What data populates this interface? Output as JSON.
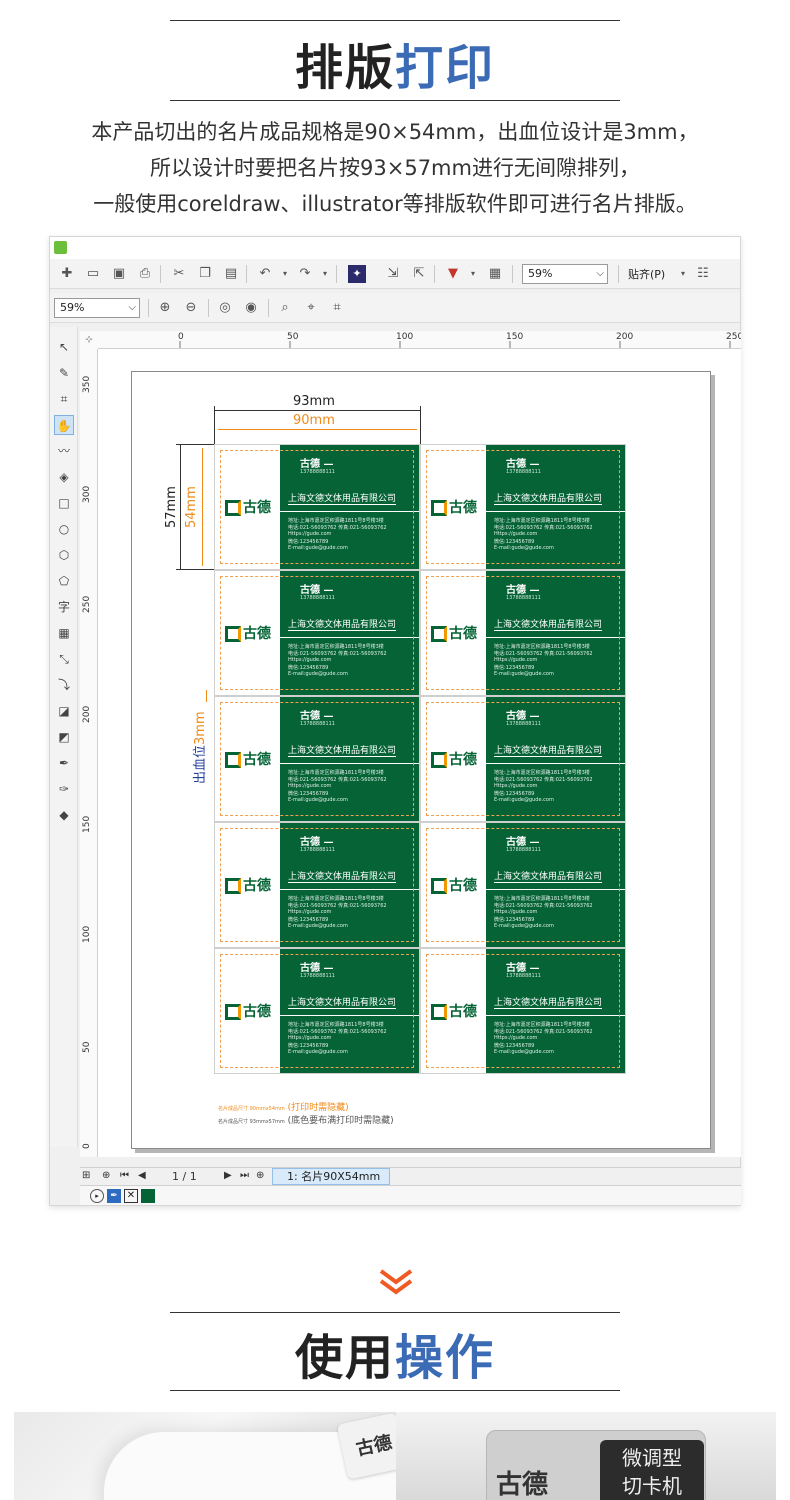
{
  "section1": {
    "title_black": "排版",
    "title_blue": "打印"
  },
  "intro": [
    "本产品切出的名片成品规格是90×54mm，出血位设计是3mm，",
    "所以设计时要把名片按93×57mm进行无间隙排列，",
    "一般使用coreldraw、illustrator等排版软件即可进行名片排版。"
  ],
  "app": {
    "zoom": "59%",
    "zoom_secondary": "59%",
    "snap_label": "贴齐(P)",
    "ruler_h": [
      "0",
      "50",
      "100",
      "150",
      "200",
      "250"
    ],
    "ruler_v": [
      "350",
      "300",
      "250",
      "200",
      "150",
      "100",
      "50",
      "0"
    ],
    "ruler_unit": "毫米",
    "page_indicator": "1 / 1",
    "page_tab": "1: 名片90X54mm",
    "colors": {
      "accent": "#3b6bb5",
      "card_green": "#056336",
      "orange": "#f08a1a",
      "bleed_blue": "#1f3f9b"
    }
  },
  "layout_labels": {
    "width_outer": "93mm",
    "width_inner": "90mm",
    "height_outer": "57mm",
    "height_inner": "54mm",
    "bleed": "出血位",
    "bleed_size": "3mm",
    "note1_small": "名片成品尺寸 90mmx54mm",
    "note1": "(打印时需隐藏)",
    "note2_small": "名片成品尺寸 93mmx57mm",
    "note2": "(底色要布满打印时需隐藏)"
  },
  "card": {
    "logo_text": "古德",
    "name": "古德 —",
    "phone": "13788888111",
    "company": "上海文德文体用品有限公司",
    "info_lines": [
      "地址:上海市嘉定区积源路1811号8号楼3楼",
      "电话:021-56093762     传真:021-56093762",
      "Https://gude.com",
      "微信:123456789",
      "E-mail:gude@gude.com"
    ]
  },
  "section2": {
    "title_black": "使用",
    "title_blue": "操作"
  },
  "photo_right": {
    "label_line1": "微调型",
    "label_line2": "切卡机"
  }
}
